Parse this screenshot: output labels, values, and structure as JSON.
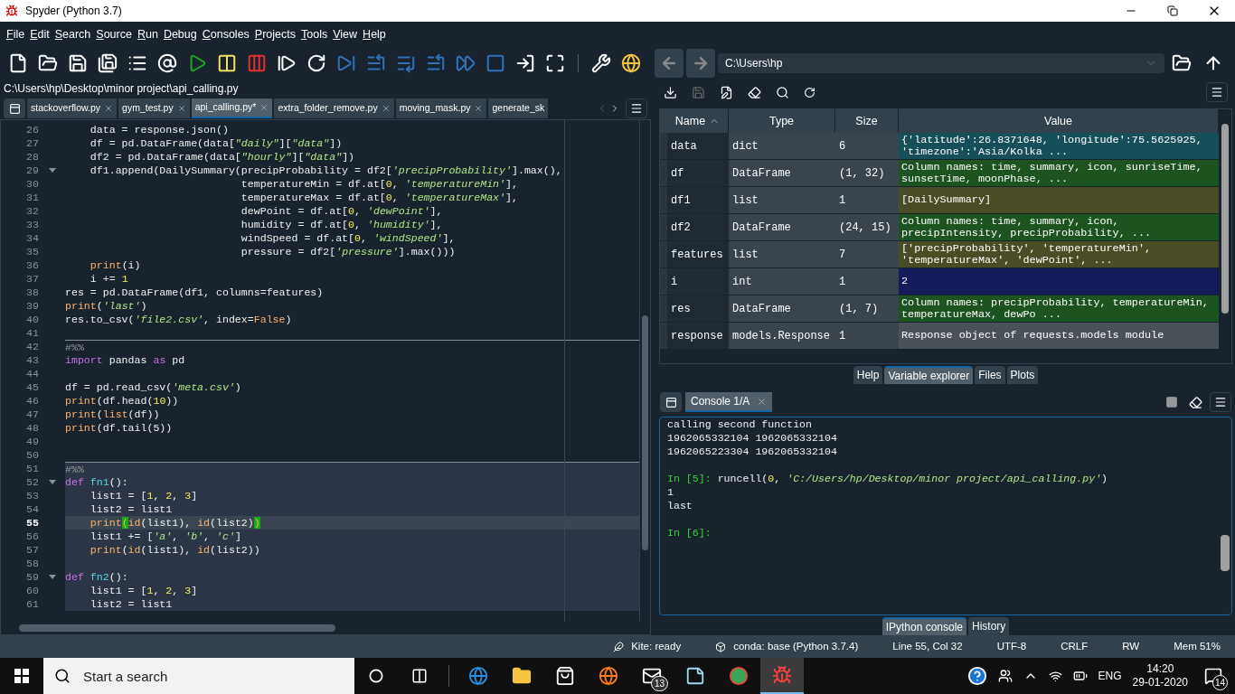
{
  "window": {
    "title": "Spyder (Python 3.7)"
  },
  "menu": [
    "File",
    "Edit",
    "Search",
    "Source",
    "Run",
    "Debug",
    "Consoles",
    "Projects",
    "Tools",
    "View",
    "Help"
  ],
  "working_directory": "C:\\Users\\hp",
  "editor": {
    "path": "C:\\Users\\hp\\Desktop\\minor project\\api_calling.py",
    "tabs": [
      {
        "label": "stackoverflow.py",
        "selected": false
      },
      {
        "label": "gym_test.py",
        "selected": false
      },
      {
        "label": "api_calling.py*",
        "selected": true
      },
      {
        "label": "extra_folder_remove.py",
        "selected": false
      },
      {
        "label": "moving_mask.py",
        "selected": false
      },
      {
        "label": "generate_sk",
        "selected": false
      }
    ],
    "lines": [
      {
        "number": "26",
        "fold": false,
        "cell_start": false,
        "in_cell": false,
        "current": false,
        "tokens": [
          {
            "text": "    data = response.json()",
            "kind": "plain"
          }
        ]
      },
      {
        "number": "27",
        "fold": false,
        "cell_start": false,
        "in_cell": false,
        "current": false,
        "tokens": [
          {
            "text": "    df = pd.DataFrame(data[",
            "kind": "plain"
          },
          {
            "text": "\"daily\"",
            "kind": "string"
          },
          {
            "text": "][",
            "kind": "plain"
          },
          {
            "text": "\"data\"",
            "kind": "string"
          },
          {
            "text": "])",
            "kind": "plain"
          }
        ]
      },
      {
        "number": "28",
        "fold": false,
        "cell_start": false,
        "in_cell": false,
        "current": false,
        "tokens": [
          {
            "text": "    df2 = pd.DataFrame(data[",
            "kind": "plain"
          },
          {
            "text": "\"hourly\"",
            "kind": "string"
          },
          {
            "text": "][",
            "kind": "plain"
          },
          {
            "text": "\"data\"",
            "kind": "string"
          },
          {
            "text": "])",
            "kind": "plain"
          }
        ]
      },
      {
        "number": "29",
        "fold": true,
        "cell_start": false,
        "in_cell": false,
        "current": false,
        "tokens": [
          {
            "text": "    df1.append(DailySummary(precipProbability = df2[",
            "kind": "plain"
          },
          {
            "text": "'precipProbability'",
            "kind": "string"
          },
          {
            "text": "].max(),",
            "kind": "plain"
          }
        ]
      },
      {
        "number": "30",
        "fold": false,
        "cell_start": false,
        "in_cell": false,
        "current": false,
        "tokens": [
          {
            "text": "                            temperatureMin = df.at[",
            "kind": "plain"
          },
          {
            "text": "0",
            "kind": "number"
          },
          {
            "text": ", ",
            "kind": "plain"
          },
          {
            "text": "'temperatureMin'",
            "kind": "string"
          },
          {
            "text": "],",
            "kind": "plain"
          }
        ]
      },
      {
        "number": "31",
        "fold": false,
        "cell_start": false,
        "in_cell": false,
        "current": false,
        "tokens": [
          {
            "text": "                            temperatureMax = df.at[",
            "kind": "plain"
          },
          {
            "text": "0",
            "kind": "number"
          },
          {
            "text": ", ",
            "kind": "plain"
          },
          {
            "text": "'temperatureMax'",
            "kind": "string"
          },
          {
            "text": "],",
            "kind": "plain"
          }
        ]
      },
      {
        "number": "32",
        "fold": false,
        "cell_start": false,
        "in_cell": false,
        "current": false,
        "tokens": [
          {
            "text": "                            dewPoint = df.at[",
            "kind": "plain"
          },
          {
            "text": "0",
            "kind": "number"
          },
          {
            "text": ", ",
            "kind": "plain"
          },
          {
            "text": "'dewPoint'",
            "kind": "string"
          },
          {
            "text": "],",
            "kind": "plain"
          }
        ]
      },
      {
        "number": "33",
        "fold": false,
        "cell_start": false,
        "in_cell": false,
        "current": false,
        "tokens": [
          {
            "text": "                            humidity = df.at[",
            "kind": "plain"
          },
          {
            "text": "0",
            "kind": "number"
          },
          {
            "text": ", ",
            "kind": "plain"
          },
          {
            "text": "'humidity'",
            "kind": "string"
          },
          {
            "text": "],",
            "kind": "plain"
          }
        ]
      },
      {
        "number": "34",
        "fold": false,
        "cell_start": false,
        "in_cell": false,
        "current": false,
        "tokens": [
          {
            "text": "                            windSpeed = df.at[",
            "kind": "plain"
          },
          {
            "text": "0",
            "kind": "number"
          },
          {
            "text": ", ",
            "kind": "plain"
          },
          {
            "text": "'windSpeed'",
            "kind": "string"
          },
          {
            "text": "],",
            "kind": "plain"
          }
        ]
      },
      {
        "number": "35",
        "fold": false,
        "cell_start": false,
        "in_cell": false,
        "current": false,
        "tokens": [
          {
            "text": "                            pressure = df2[",
            "kind": "plain"
          },
          {
            "text": "'pressure'",
            "kind": "string"
          },
          {
            "text": "].max()))",
            "kind": "plain"
          }
        ]
      },
      {
        "number": "36",
        "fold": false,
        "cell_start": false,
        "in_cell": false,
        "current": false,
        "tokens": [
          {
            "text": "    print",
            "kind": "builtin"
          },
          {
            "text": "(i)",
            "kind": "plain"
          }
        ]
      },
      {
        "number": "37",
        "fold": false,
        "cell_start": false,
        "in_cell": false,
        "current": false,
        "tokens": [
          {
            "text": "    i += ",
            "kind": "plain"
          },
          {
            "text": "1",
            "kind": "number"
          }
        ]
      },
      {
        "number": "38",
        "fold": false,
        "cell_start": false,
        "in_cell": false,
        "current": false,
        "tokens": [
          {
            "text": "res = pd.DataFrame(df1, columns=features)",
            "kind": "plain"
          }
        ]
      },
      {
        "number": "39",
        "fold": false,
        "cell_start": false,
        "in_cell": false,
        "current": false,
        "tokens": [
          {
            "text": "print",
            "kind": "builtin"
          },
          {
            "text": "(",
            "kind": "plain"
          },
          {
            "text": "'last'",
            "kind": "string"
          },
          {
            "text": ")",
            "kind": "plain"
          }
        ]
      },
      {
        "number": "40",
        "fold": false,
        "cell_start": false,
        "in_cell": false,
        "current": false,
        "tokens": [
          {
            "text": "res.to_csv(",
            "kind": "plain"
          },
          {
            "text": "'file2.csv'",
            "kind": "string"
          },
          {
            "text": ", index=",
            "kind": "plain"
          },
          {
            "text": "False",
            "kind": "builtin"
          },
          {
            "text": ")",
            "kind": "plain"
          }
        ]
      },
      {
        "number": "41",
        "fold": false,
        "cell_start": false,
        "in_cell": false,
        "current": false
      },
      {
        "number": "42",
        "fold": false,
        "cell_start": true,
        "in_cell": false,
        "current": false,
        "tokens": [
          {
            "text": "#%%",
            "kind": "comment"
          }
        ]
      },
      {
        "number": "43",
        "fold": false,
        "cell_start": false,
        "in_cell": false,
        "current": false,
        "tokens": [
          {
            "text": "import",
            "kind": "keyword"
          },
          {
            "text": " pandas ",
            "kind": "plain"
          },
          {
            "text": "as",
            "kind": "keyword"
          },
          {
            "text": " pd",
            "kind": "plain"
          }
        ]
      },
      {
        "number": "44",
        "fold": false,
        "cell_start": false,
        "in_cell": false,
        "current": false
      },
      {
        "number": "45",
        "fold": false,
        "cell_start": false,
        "in_cell": false,
        "current": false,
        "tokens": [
          {
            "text": "df = pd.read_csv(",
            "kind": "plain"
          },
          {
            "text": "'meta.csv'",
            "kind": "string"
          },
          {
            "text": ")",
            "kind": "plain"
          }
        ]
      },
      {
        "number": "46",
        "fold": false,
        "cell_start": false,
        "in_cell": false,
        "current": false,
        "tokens": [
          {
            "text": "print",
            "kind": "builtin"
          },
          {
            "text": "(df.head(",
            "kind": "plain"
          },
          {
            "text": "10",
            "kind": "number"
          },
          {
            "text": "))",
            "kind": "plain"
          }
        ]
      },
      {
        "number": "47",
        "fold": false,
        "cell_start": false,
        "in_cell": false,
        "current": false,
        "tokens": [
          {
            "text": "print",
            "kind": "builtin"
          },
          {
            "text": "(",
            "kind": "plain"
          },
          {
            "text": "list",
            "kind": "builtin"
          },
          {
            "text": "(df))",
            "kind": "plain"
          }
        ]
      },
      {
        "number": "48",
        "fold": false,
        "cell_start": false,
        "in_cell": false,
        "current": false,
        "tokens": [
          {
            "text": "print",
            "kind": "builtin"
          },
          {
            "text": "(df.tail(5))",
            "kind": "plain"
          }
        ]
      },
      {
        "number": "49",
        "fold": false,
        "cell_start": false,
        "in_cell": false,
        "current": false
      },
      {
        "number": "50",
        "fold": false,
        "cell_start": false,
        "in_cell": false,
        "current": false
      },
      {
        "number": "51",
        "fold": false,
        "cell_start": true,
        "in_cell": true,
        "current": false,
        "tokens": [
          {
            "text": "#%%",
            "kind": "comment"
          }
        ]
      },
      {
        "number": "52",
        "fold": true,
        "cell_start": false,
        "in_cell": true,
        "current": false,
        "tokens": [
          {
            "text": "def ",
            "kind": "keyword"
          },
          {
            "text": "fn1",
            "kind": "function"
          },
          {
            "text": "():",
            "kind": "plain"
          }
        ]
      },
      {
        "number": "53",
        "fold": false,
        "cell_start": false,
        "in_cell": true,
        "current": false,
        "tokens": [
          {
            "text": "    list1 = [",
            "kind": "plain"
          },
          {
            "text": "1",
            "kind": "number"
          },
          {
            "text": ", ",
            "kind": "plain"
          },
          {
            "text": "2",
            "kind": "number"
          },
          {
            "text": ", ",
            "kind": "plain"
          },
          {
            "text": "3",
            "kind": "number"
          },
          {
            "text": "]",
            "kind": "plain"
          }
        ]
      },
      {
        "number": "54",
        "fold": false,
        "cell_start": false,
        "in_cell": true,
        "current": false,
        "tokens": [
          {
            "text": "    list2 = list1",
            "kind": "plain"
          }
        ]
      },
      {
        "number": "55",
        "fold": false,
        "cell_start": false,
        "in_cell": true,
        "current": true,
        "tokens": [
          {
            "text": "    print",
            "kind": "builtin"
          },
          {
            "text": "(",
            "kind": "bracket_match"
          },
          {
            "text": "id",
            "kind": "builtin"
          },
          {
            "text": "(list1), ",
            "kind": "plain"
          },
          {
            "text": "id",
            "kind": "builtin"
          },
          {
            "text": "(list2)",
            "kind": "plain"
          },
          {
            "text": ")",
            "kind": "bracket_match"
          }
        ]
      },
      {
        "number": "56",
        "fold": false,
        "cell_start": false,
        "in_cell": true,
        "current": false,
        "tokens": [
          {
            "text": "    list1 += [",
            "kind": "plain"
          },
          {
            "text": "'a'",
            "kind": "string"
          },
          {
            "text": ", ",
            "kind": "plain"
          },
          {
            "text": "'b'",
            "kind": "string"
          },
          {
            "text": ", ",
            "kind": "plain"
          },
          {
            "text": "'c'",
            "kind": "string"
          },
          {
            "text": "]",
            "kind": "plain"
          }
        ]
      },
      {
        "number": "57",
        "fold": false,
        "cell_start": false,
        "in_cell": true,
        "current": false,
        "tokens": [
          {
            "text": "    print",
            "kind": "builtin"
          },
          {
            "text": "(",
            "kind": "plain"
          },
          {
            "text": "id",
            "kind": "builtin"
          },
          {
            "text": "(list1), ",
            "kind": "plain"
          },
          {
            "text": "id",
            "kind": "builtin"
          },
          {
            "text": "(list2))",
            "kind": "plain"
          }
        ]
      },
      {
        "number": "58",
        "fold": false,
        "cell_start": false,
        "in_cell": true,
        "current": false
      },
      {
        "number": "59",
        "fold": true,
        "cell_start": false,
        "in_cell": true,
        "current": false,
        "tokens": [
          {
            "text": "def ",
            "kind": "keyword"
          },
          {
            "text": "fn2",
            "kind": "function"
          },
          {
            "text": "():",
            "kind": "plain"
          }
        ]
      },
      {
        "number": "60",
        "fold": false,
        "cell_start": false,
        "in_cell": true,
        "current": false,
        "tokens": [
          {
            "text": "    list1 = [",
            "kind": "plain"
          },
          {
            "text": "1",
            "kind": "number"
          },
          {
            "text": ", ",
            "kind": "plain"
          },
          {
            "text": "2",
            "kind": "number"
          },
          {
            "text": ", ",
            "kind": "plain"
          },
          {
            "text": "3",
            "kind": "number"
          },
          {
            "text": "]",
            "kind": "plain"
          }
        ]
      },
      {
        "number": "61",
        "fold": false,
        "cell_start": false,
        "in_cell": true,
        "current": false,
        "tokens": [
          {
            "text": "    list2 = list1",
            "kind": "plain"
          }
        ]
      }
    ]
  },
  "variable_explorer": {
    "columns": [
      {
        "label": "Name",
        "sorted": true
      },
      {
        "label": "Type",
        "sorted": false
      },
      {
        "label": "Size",
        "sorted": false
      },
      {
        "label": "Value",
        "sorted": false
      }
    ],
    "rows": [
      {
        "name": "data",
        "type": "dict",
        "size": "6",
        "value": "{'latitude':26.8371648, 'longitude':75.5625925, 'timezone':'Asia/Kolka ...",
        "color": "#155058"
      },
      {
        "name": "df",
        "type": "DataFrame",
        "size": "(1, 32)",
        "value": "Column names: time, summary, icon, sunriseTime, sunsetTime, moonPhase, ...",
        "color": "#1b5321"
      },
      {
        "name": "df1",
        "type": "list",
        "size": "1",
        "value": "[DailySummary]",
        "color": "#4a4c25"
      },
      {
        "name": "df2",
        "type": "DataFrame",
        "size": "(24, 15)",
        "value": "Column names: time, summary, icon, precipIntensity, precipProbability, ...",
        "color": "#1b5321"
      },
      {
        "name": "features",
        "type": "list",
        "size": "7",
        "value": "['precipProbability', 'temperatureMin', 'temperatureMax', 'dewPoint', ...",
        "color": "#4a4c25"
      },
      {
        "name": "i",
        "type": "int",
        "size": "1",
        "value": "2",
        "color": "#141a5a"
      },
      {
        "name": "res",
        "type": "DataFrame",
        "size": "(1, 7)",
        "value": "Column names: precipProbability, temperatureMin, temperatureMax, dewPo ...",
        "color": "#1b5321"
      },
      {
        "name": "response",
        "type": "models.Response",
        "size": "1",
        "value": "Response object of requests.models module",
        "color": "#4b5158"
      }
    ]
  },
  "top_pane_tabs": [
    {
      "label": "Help",
      "selected": false
    },
    {
      "label": "Variable explorer",
      "selected": true
    },
    {
      "label": "Files",
      "selected": false
    },
    {
      "label": "Plots",
      "selected": false
    }
  ],
  "console": {
    "tab": {
      "label": "Console 1/A",
      "selected": true
    },
    "blocks": [
      {
        "lines": [
          {
            "tokens": [
              {
                "text": "calling second function",
                "kind": "plain"
              }
            ]
          },
          {
            "tokens": [
              {
                "text": "1962065332104 1962065332104",
                "kind": "plain"
              }
            ]
          },
          {
            "tokens": [
              {
                "text": "1962065223304 1962065332104",
                "kind": "plain"
              }
            ]
          }
        ]
      },
      {
        "lines": [
          {
            "tokens": [
              {
                "text": "In [5]:",
                "kind": "prompt"
              },
              {
                "text": " runcell(",
                "kind": "plain"
              },
              {
                "text": "0",
                "kind": "number"
              },
              {
                "text": ", ",
                "kind": "plain"
              },
              {
                "text": "'C:/Users/hp/Desktop/minor project/api_calling.py'",
                "kind": "string"
              },
              {
                "text": ")",
                "kind": "plain"
              }
            ]
          },
          {
            "tokens": [
              {
                "text": "1",
                "kind": "plain"
              }
            ]
          },
          {
            "tokens": [
              {
                "text": "last",
                "kind": "plain"
              }
            ]
          }
        ]
      },
      {
        "lines": [
          {
            "tokens": [
              {
                "text": "In [6]:",
                "kind": "prompt"
              }
            ]
          }
        ]
      }
    ]
  },
  "bottom_pane_tabs": [
    {
      "label": "IPython console",
      "selected": true
    },
    {
      "label": "History",
      "selected": false
    }
  ],
  "status_bar": [
    {
      "kind": "kite",
      "text": "Kite: ready"
    },
    {
      "kind": "conda",
      "text": "conda: base (Python 3.7.4)"
    },
    {
      "kind": "plain",
      "text": "Line 55, Col 32"
    },
    {
      "kind": "plain",
      "text": "UTF-8"
    },
    {
      "kind": "plain",
      "text": "CRLF"
    },
    {
      "kind": "plain",
      "text": "RW"
    },
    {
      "kind": "plain",
      "text": "Mem 51%"
    }
  ],
  "taskbar": {
    "search": {
      "placeholder": "Start a search"
    },
    "apps": [
      {
        "kind": "edge",
        "active": false
      },
      {
        "kind": "folder",
        "active": false
      },
      {
        "kind": "store",
        "active": false
      },
      {
        "kind": "firefox",
        "active": false
      },
      {
        "kind": "mail",
        "active": false,
        "badge": "13"
      },
      {
        "kind": "notes",
        "active": false
      },
      {
        "kind": "chrome",
        "active": false
      },
      {
        "kind": "spyder",
        "active": true
      }
    ],
    "language": "ENG",
    "time": "14:20",
    "date": "29-01-2020",
    "notifications": "14"
  }
}
